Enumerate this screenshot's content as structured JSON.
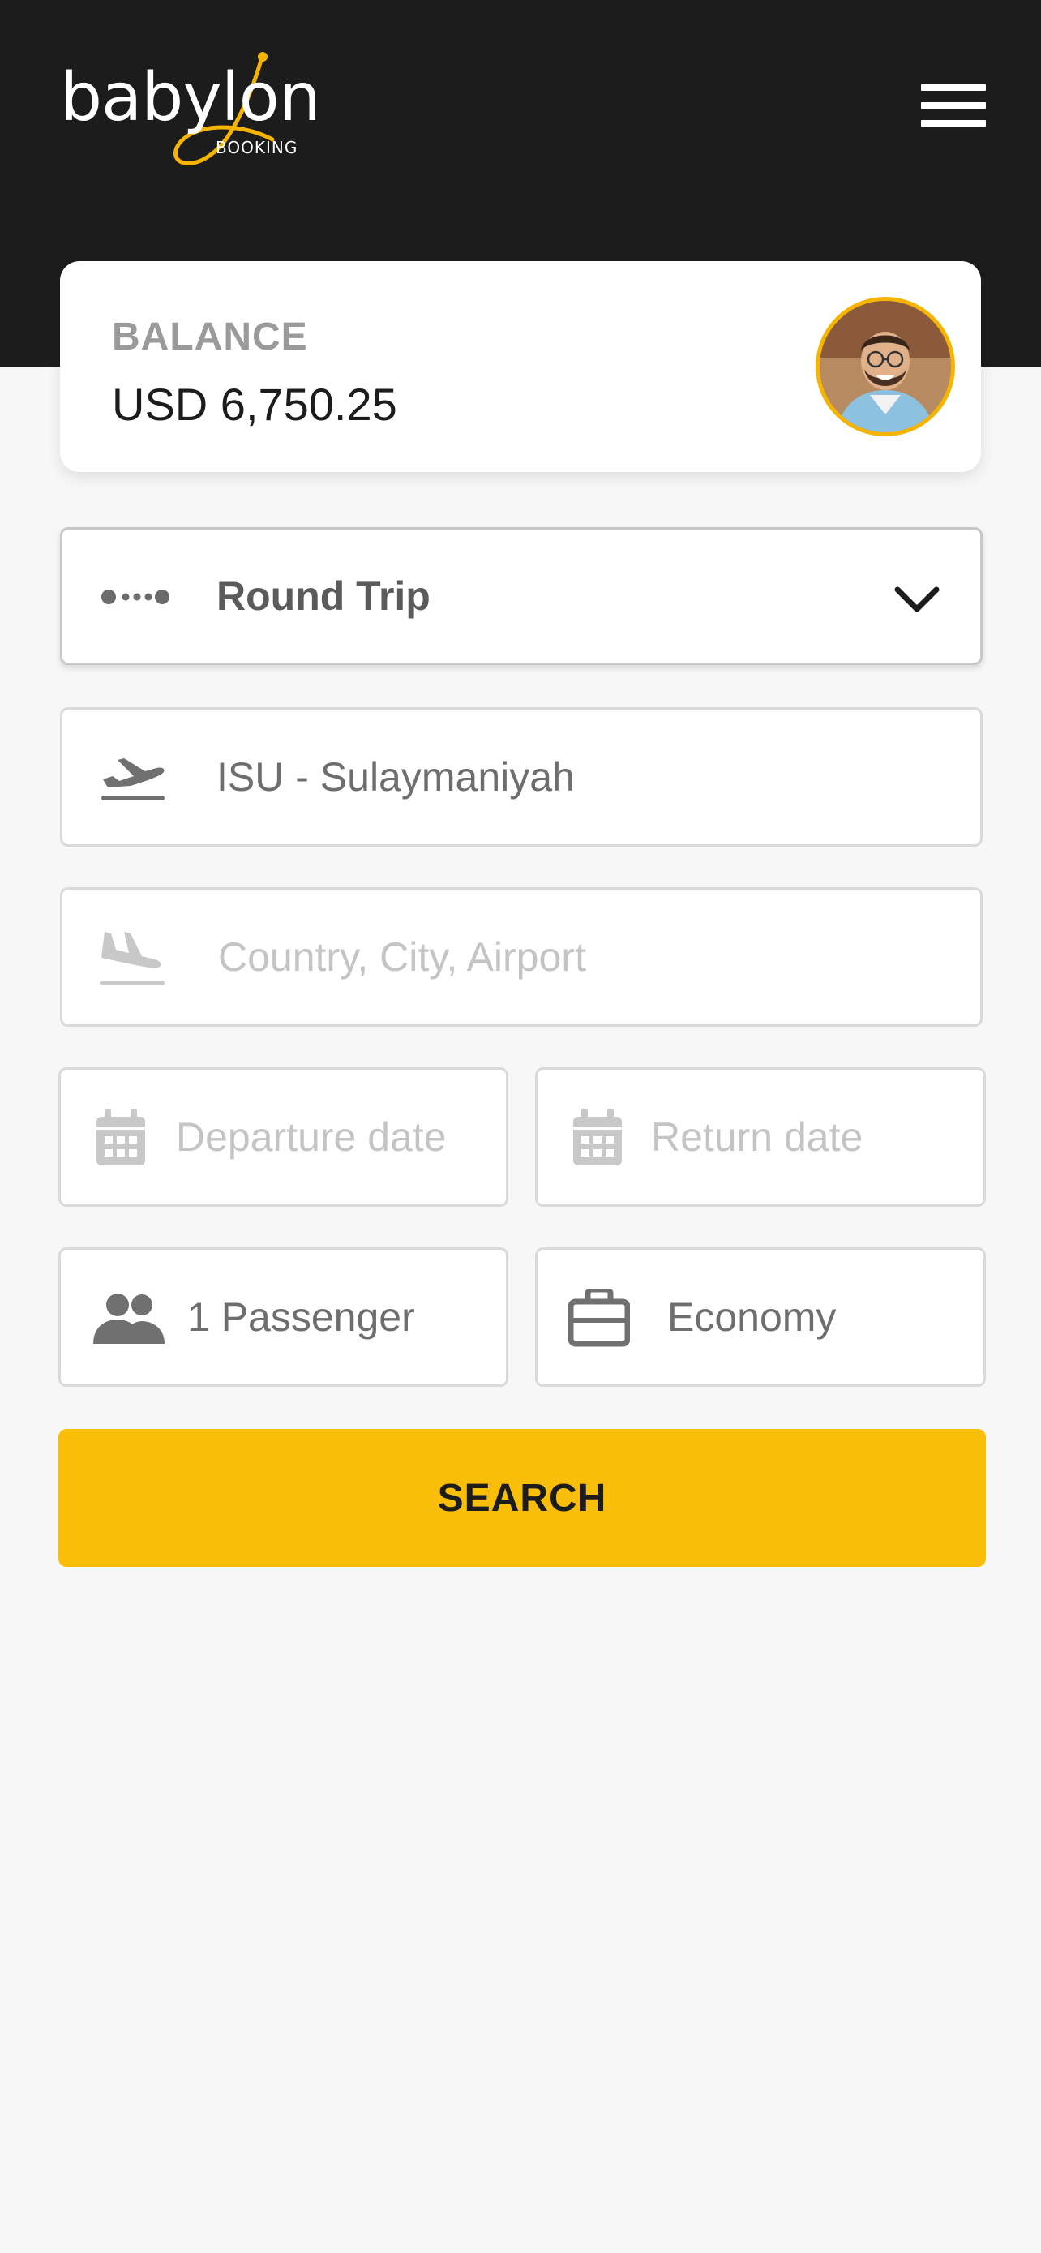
{
  "header": {
    "logo": {
      "name": "babylon",
      "sub": "BOOKING"
    },
    "menu_icon": "hamburger-menu-icon"
  },
  "balance": {
    "label": "BALANCE",
    "value": "USD 6,750.25"
  },
  "trip_type": {
    "selected": "Round Trip",
    "icon": "round-trip-dots-icon"
  },
  "origin": {
    "value": "ISU - Sulaymaniyah",
    "icon": "takeoff-icon"
  },
  "destination": {
    "placeholder": "Country, City, Airport",
    "icon": "landing-icon"
  },
  "dates": {
    "departure_placeholder": "Departure date",
    "return_placeholder": "Return date"
  },
  "passengers": {
    "value": "1 Passenger"
  },
  "cabin_class": {
    "value": "Economy"
  },
  "search_button": {
    "label": "SEARCH"
  },
  "colors": {
    "header_bg": "#1c1c1c",
    "accent": "#f8be0a",
    "page_bg": "#f7f7f7"
  }
}
